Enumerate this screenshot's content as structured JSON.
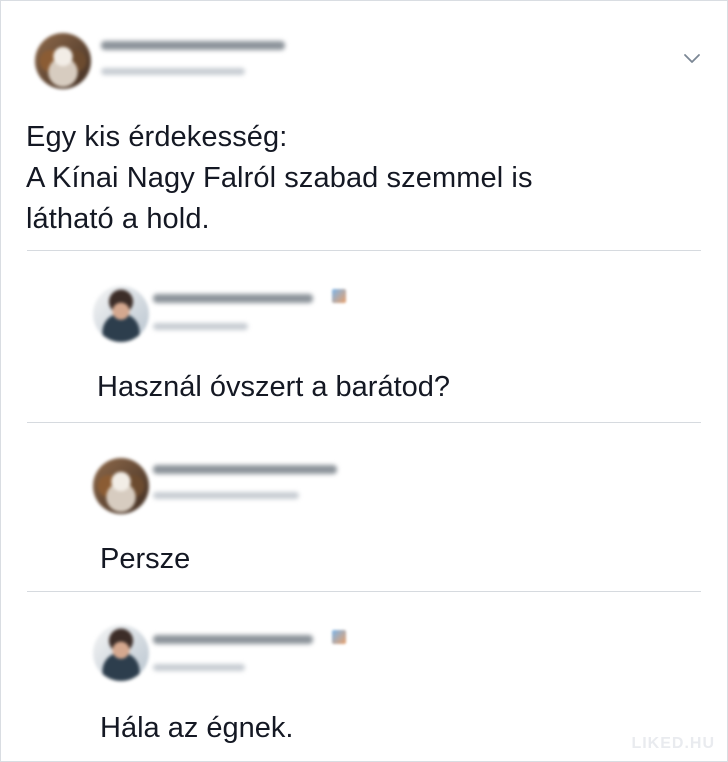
{
  "post": {
    "text": "Egy kis érdekesség:\nA Kínai Nagy Falról szabad szemmel is\nlátható a hold.",
    "menu_icon": "chevron-down-icon"
  },
  "replies": [
    {
      "text": "Használ óvszert a barátod?"
    },
    {
      "text": "Persze"
    },
    {
      "text": "Hála az égnek."
    }
  ],
  "watermark": "LIKED.HU",
  "colors": {
    "text": "#141823",
    "divider": "#d6dadf",
    "chevron": "#7b8794"
  }
}
